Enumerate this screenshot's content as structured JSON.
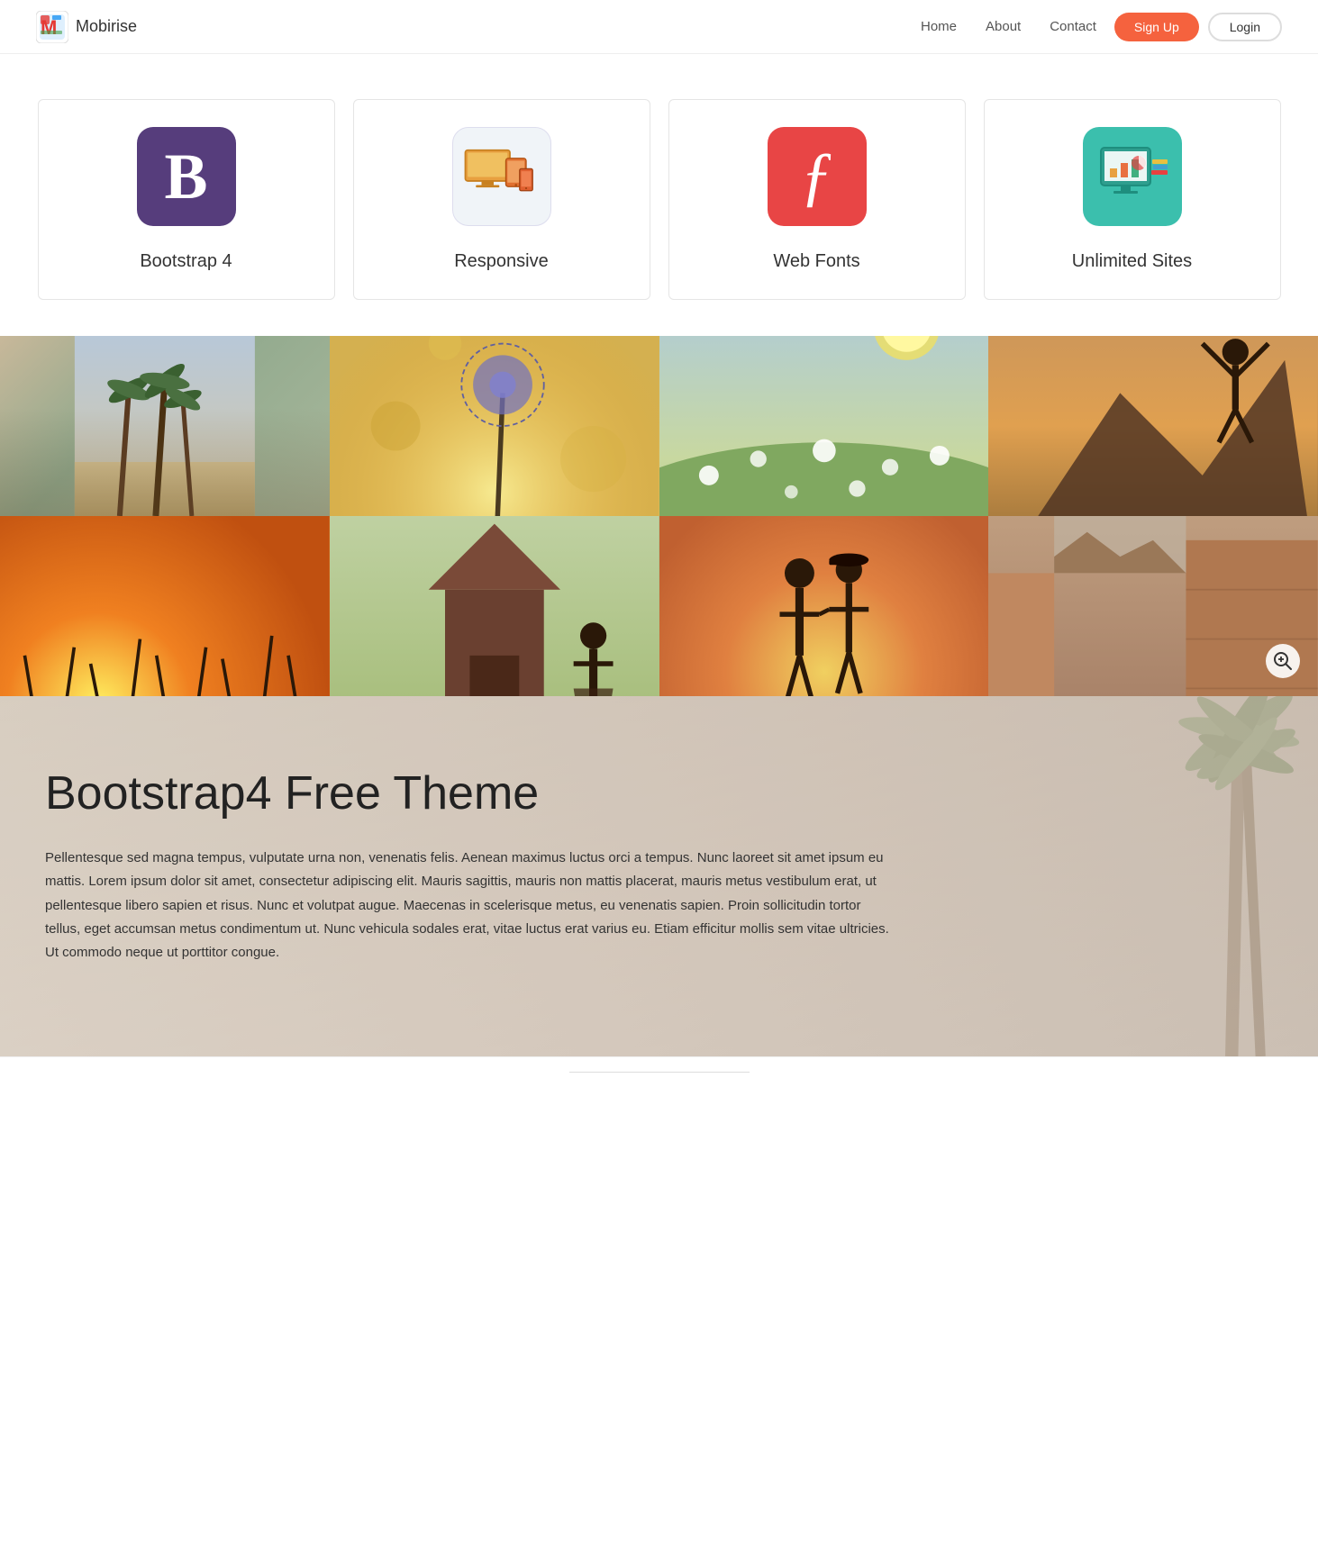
{
  "nav": {
    "brand": "Mobirise",
    "links": [
      {
        "label": "Home",
        "href": "#"
      },
      {
        "label": "About",
        "href": "#"
      },
      {
        "label": "Contact",
        "href": "#"
      }
    ],
    "signup_label": "Sign Up",
    "login_label": "Login"
  },
  "features": {
    "cards": [
      {
        "id": "bootstrap",
        "icon_label": "B",
        "title": "Bootstrap 4",
        "icon_type": "bootstrap"
      },
      {
        "id": "responsive",
        "icon_label": "devices",
        "title": "Responsive",
        "icon_type": "responsive"
      },
      {
        "id": "webfonts",
        "icon_label": "F",
        "title": "Web Fonts",
        "icon_type": "webfonts"
      },
      {
        "id": "unlimited",
        "icon_label": "sites",
        "title": "Unlimited Sites",
        "icon_type": "unlimited"
      }
    ]
  },
  "gallery": {
    "zoom_icon_label": "⊕",
    "cells": [
      {
        "id": "cell-1",
        "class": "photo-1"
      },
      {
        "id": "cell-2",
        "class": "photo-2"
      },
      {
        "id": "cell-3",
        "class": "photo-3"
      },
      {
        "id": "cell-4",
        "class": "photo-4"
      },
      {
        "id": "cell-5",
        "class": "photo-5"
      },
      {
        "id": "cell-6",
        "class": "photo-6"
      },
      {
        "id": "cell-7",
        "class": "photo-7"
      },
      {
        "id": "cell-8",
        "class": "photo-8"
      }
    ]
  },
  "content": {
    "heading": "Bootstrap4 Free Theme",
    "body": "Pellentesque sed magna tempus, vulputate urna non, venenatis felis. Aenean maximus luctus orci a tempus. Nunc laoreet sit amet ipsum eu mattis. Lorem ipsum dolor sit amet, consectetur adipiscing elit. Mauris sagittis, mauris non mattis placerat, mauris metus vestibulum erat, ut pellentesque libero sapien et risus. Nunc et volutpat augue. Maecenas in scelerisque metus, eu venenatis sapien. Proin sollicitudin tortor tellus, eget accumsan metus condimentum ut. Nunc vehicula sodales erat, vitae luctus erat varius eu. Etiam efficitur mollis sem vitae ultricies. Ut commodo neque ut porttitor congue."
  }
}
